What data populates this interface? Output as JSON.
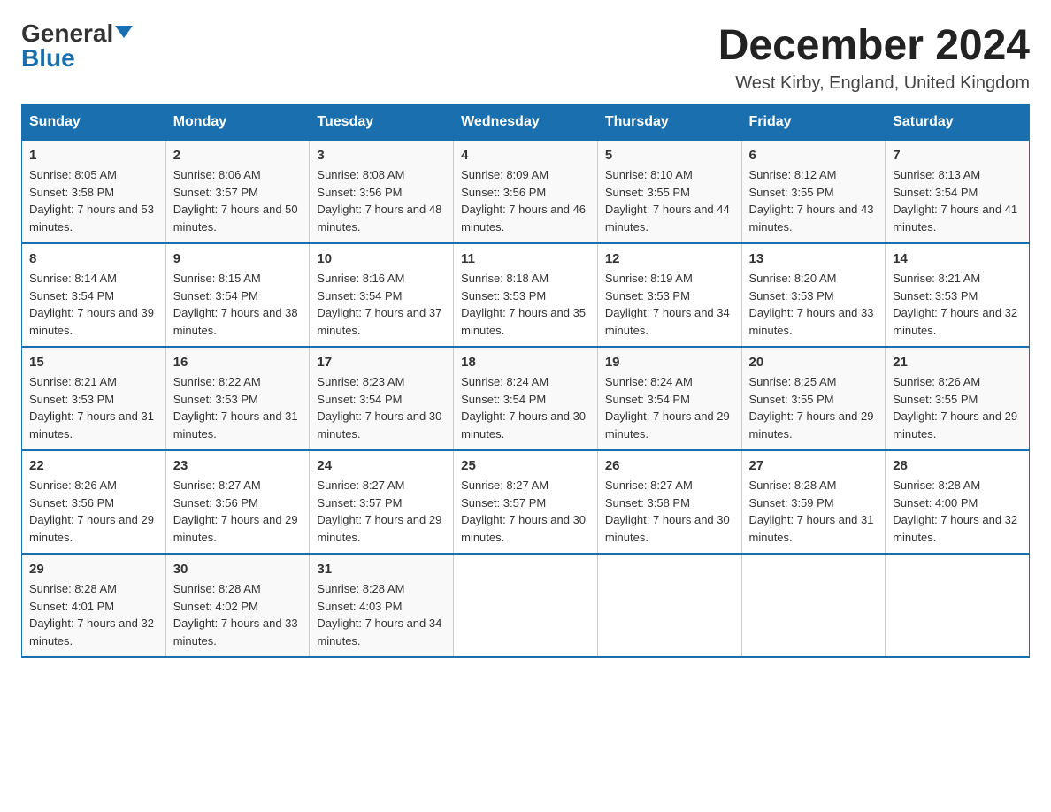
{
  "header": {
    "logo_general": "General",
    "logo_blue": "Blue",
    "month_title": "December 2024",
    "location": "West Kirby, England, United Kingdom"
  },
  "weekdays": [
    "Sunday",
    "Monday",
    "Tuesday",
    "Wednesday",
    "Thursday",
    "Friday",
    "Saturday"
  ],
  "weeks": [
    [
      {
        "day": "1",
        "sunrise": "8:05 AM",
        "sunset": "3:58 PM",
        "daylight": "7 hours and 53 minutes."
      },
      {
        "day": "2",
        "sunrise": "8:06 AM",
        "sunset": "3:57 PM",
        "daylight": "7 hours and 50 minutes."
      },
      {
        "day": "3",
        "sunrise": "8:08 AM",
        "sunset": "3:56 PM",
        "daylight": "7 hours and 48 minutes."
      },
      {
        "day": "4",
        "sunrise": "8:09 AM",
        "sunset": "3:56 PM",
        "daylight": "7 hours and 46 minutes."
      },
      {
        "day": "5",
        "sunrise": "8:10 AM",
        "sunset": "3:55 PM",
        "daylight": "7 hours and 44 minutes."
      },
      {
        "day": "6",
        "sunrise": "8:12 AM",
        "sunset": "3:55 PM",
        "daylight": "7 hours and 43 minutes."
      },
      {
        "day": "7",
        "sunrise": "8:13 AM",
        "sunset": "3:54 PM",
        "daylight": "7 hours and 41 minutes."
      }
    ],
    [
      {
        "day": "8",
        "sunrise": "8:14 AM",
        "sunset": "3:54 PM",
        "daylight": "7 hours and 39 minutes."
      },
      {
        "day": "9",
        "sunrise": "8:15 AM",
        "sunset": "3:54 PM",
        "daylight": "7 hours and 38 minutes."
      },
      {
        "day": "10",
        "sunrise": "8:16 AM",
        "sunset": "3:54 PM",
        "daylight": "7 hours and 37 minutes."
      },
      {
        "day": "11",
        "sunrise": "8:18 AM",
        "sunset": "3:53 PM",
        "daylight": "7 hours and 35 minutes."
      },
      {
        "day": "12",
        "sunrise": "8:19 AM",
        "sunset": "3:53 PM",
        "daylight": "7 hours and 34 minutes."
      },
      {
        "day": "13",
        "sunrise": "8:20 AM",
        "sunset": "3:53 PM",
        "daylight": "7 hours and 33 minutes."
      },
      {
        "day": "14",
        "sunrise": "8:21 AM",
        "sunset": "3:53 PM",
        "daylight": "7 hours and 32 minutes."
      }
    ],
    [
      {
        "day": "15",
        "sunrise": "8:21 AM",
        "sunset": "3:53 PM",
        "daylight": "7 hours and 31 minutes."
      },
      {
        "day": "16",
        "sunrise": "8:22 AM",
        "sunset": "3:53 PM",
        "daylight": "7 hours and 31 minutes."
      },
      {
        "day": "17",
        "sunrise": "8:23 AM",
        "sunset": "3:54 PM",
        "daylight": "7 hours and 30 minutes."
      },
      {
        "day": "18",
        "sunrise": "8:24 AM",
        "sunset": "3:54 PM",
        "daylight": "7 hours and 30 minutes."
      },
      {
        "day": "19",
        "sunrise": "8:24 AM",
        "sunset": "3:54 PM",
        "daylight": "7 hours and 29 minutes."
      },
      {
        "day": "20",
        "sunrise": "8:25 AM",
        "sunset": "3:55 PM",
        "daylight": "7 hours and 29 minutes."
      },
      {
        "day": "21",
        "sunrise": "8:26 AM",
        "sunset": "3:55 PM",
        "daylight": "7 hours and 29 minutes."
      }
    ],
    [
      {
        "day": "22",
        "sunrise": "8:26 AM",
        "sunset": "3:56 PM",
        "daylight": "7 hours and 29 minutes."
      },
      {
        "day": "23",
        "sunrise": "8:27 AM",
        "sunset": "3:56 PM",
        "daylight": "7 hours and 29 minutes."
      },
      {
        "day": "24",
        "sunrise": "8:27 AM",
        "sunset": "3:57 PM",
        "daylight": "7 hours and 29 minutes."
      },
      {
        "day": "25",
        "sunrise": "8:27 AM",
        "sunset": "3:57 PM",
        "daylight": "7 hours and 30 minutes."
      },
      {
        "day": "26",
        "sunrise": "8:27 AM",
        "sunset": "3:58 PM",
        "daylight": "7 hours and 30 minutes."
      },
      {
        "day": "27",
        "sunrise": "8:28 AM",
        "sunset": "3:59 PM",
        "daylight": "7 hours and 31 minutes."
      },
      {
        "day": "28",
        "sunrise": "8:28 AM",
        "sunset": "4:00 PM",
        "daylight": "7 hours and 32 minutes."
      }
    ],
    [
      {
        "day": "29",
        "sunrise": "8:28 AM",
        "sunset": "4:01 PM",
        "daylight": "7 hours and 32 minutes."
      },
      {
        "day": "30",
        "sunrise": "8:28 AM",
        "sunset": "4:02 PM",
        "daylight": "7 hours and 33 minutes."
      },
      {
        "day": "31",
        "sunrise": "8:28 AM",
        "sunset": "4:03 PM",
        "daylight": "7 hours and 34 minutes."
      },
      null,
      null,
      null,
      null
    ]
  ]
}
